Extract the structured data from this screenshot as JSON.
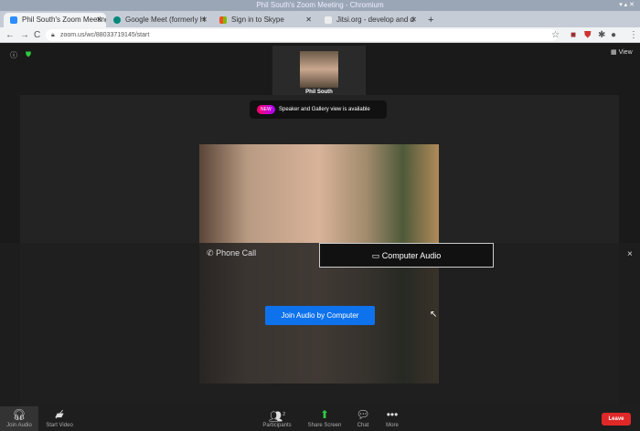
{
  "window": {
    "title": "Phil South's Zoom Meeting - Chromium",
    "controls": "▾ ▴ ✕"
  },
  "tabs": [
    {
      "label": "Phil South's Zoom Meeting",
      "color": "#2d8cff"
    },
    {
      "label": "Google Meet (formerly H",
      "color": "#00897b"
    },
    {
      "label": "Sign in to Skype",
      "color": "#f4b400"
    },
    {
      "label": "Jitsi.org - develop and d",
      "color": "#ddd"
    }
  ],
  "new_tab": "+",
  "address": {
    "url": "zoom.us/wc/88033719145/start"
  },
  "meeting": {
    "view_label": "View",
    "thumbnail_name": "Phil South",
    "tooltip_badge": "NEW",
    "tooltip_text": "Speaker and Gallery view is available",
    "audio_tabs": {
      "phone": "Phone Call",
      "computer": "Computer Audio"
    },
    "close": "×",
    "join_button": "Join Audio by Computer"
  },
  "toolbar": {
    "join_audio": "Join Audio",
    "start_video": "Start Video",
    "participants": "Participants",
    "participants_count": "2",
    "share_screen": "Share Screen",
    "chat": "Chat",
    "more": "More",
    "leave": "Leave"
  }
}
